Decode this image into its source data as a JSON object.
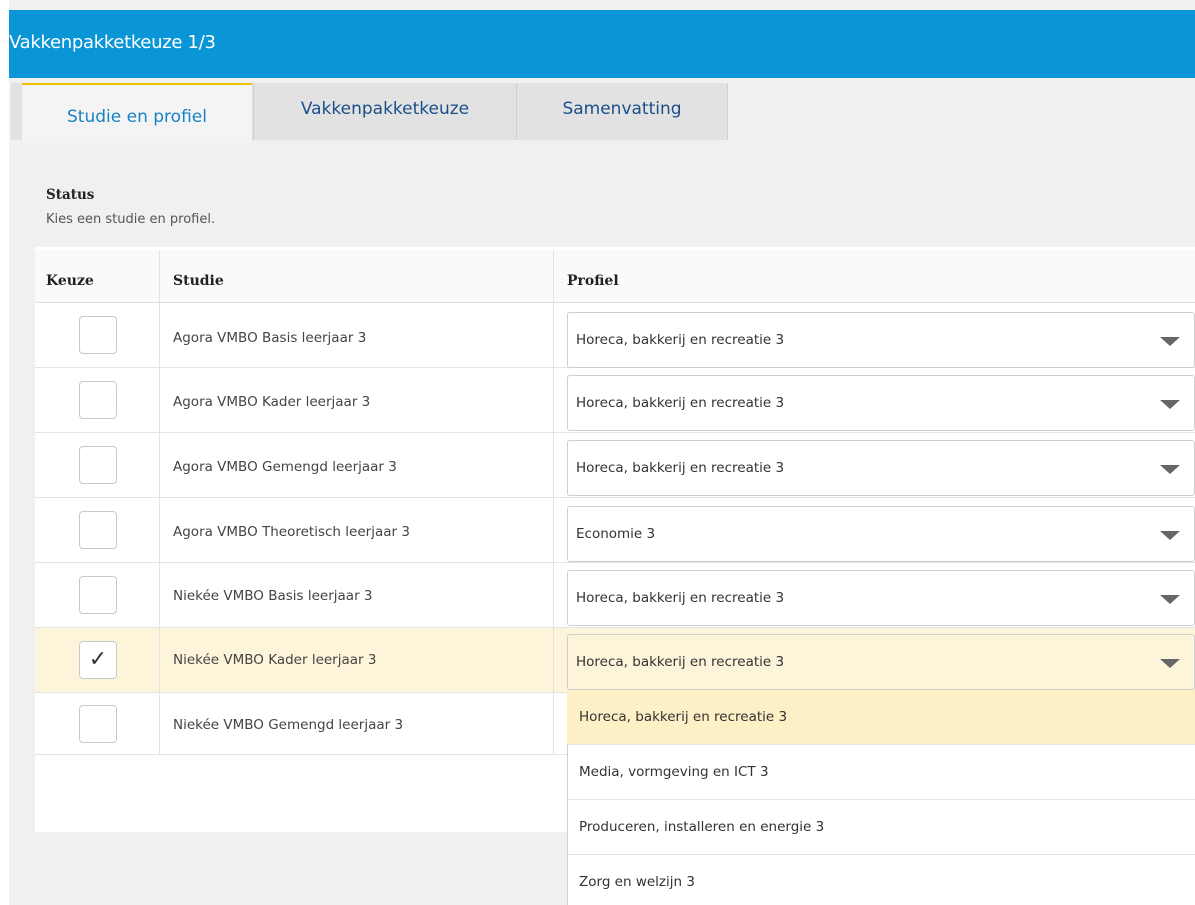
{
  "window": {
    "title": "Vakkenpakketkeuze 1/3"
  },
  "tabs": [
    {
      "label": "Studie en profiel",
      "active": true
    },
    {
      "label": "Vakkenpakketkeuze",
      "active": false
    },
    {
      "label": "Samenvatting",
      "active": false
    }
  ],
  "status": {
    "title": "Status",
    "message": "Kies een studie en profiel."
  },
  "table": {
    "headers": {
      "keuze": "Keuze",
      "studie": "Studie",
      "profiel": "Profiel"
    },
    "rows": [
      {
        "checked": "",
        "studie": "Agora VMBO Basis leerjaar 3",
        "profiel": "Horeca, bakkerij en recreatie 3"
      },
      {
        "checked": "",
        "studie": "Agora VMBO Kader leerjaar 3",
        "profiel": "Horeca, bakkerij en recreatie 3"
      },
      {
        "checked": "",
        "studie": "Agora VMBO Gemengd leerjaar 3",
        "profiel": "Horeca, bakkerij en recreatie 3"
      },
      {
        "checked": "",
        "studie": "Agora VMBO Theoretisch leerjaar 3",
        "profiel": "Economie 3"
      },
      {
        "checked": "",
        "studie": "Niekée VMBO Basis leerjaar 3",
        "profiel": "Horeca, bakkerij en recreatie 3"
      },
      {
        "checked": "✓",
        "studie": "Niekée VMBO Kader leerjaar 3",
        "profiel": "Horeca, bakkerij en recreatie 3"
      },
      {
        "checked": "",
        "studie": "Niekée VMBO Gemengd leerjaar 3",
        "profiel": ""
      }
    ]
  },
  "dropdown": {
    "options": [
      "Horeca, bakkerij en recreatie 3",
      "Media, vormgeving en ICT 3",
      "Produceren, installeren en energie 3",
      "Zorg en welzijn 3"
    ],
    "highlighted": "Horeca, bakkerij en recreatie 3"
  },
  "colors": {
    "titlebar": "#0a95d6",
    "active_tab_border": "#f2c200",
    "selected_row": "#fdf5d9",
    "highlighted_option": "#fdf0c6"
  },
  "icons": {
    "checkmark": "checkmark-icon",
    "dropdown_caret": "caret-down-icon"
  }
}
